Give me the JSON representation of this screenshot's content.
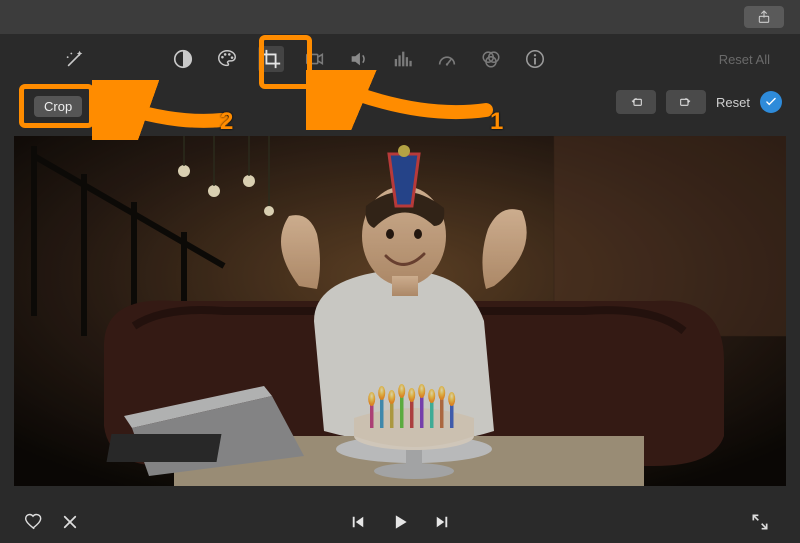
{
  "toolbar": {
    "share": "Share",
    "magic_wand": "Auto Enhance",
    "tools": [
      {
        "name": "color-balance",
        "label": "Color Balance"
      },
      {
        "name": "color-palette",
        "label": "Color Correction"
      },
      {
        "name": "crop",
        "label": "Crop"
      },
      {
        "name": "stabilize",
        "label": "Stabilization"
      },
      {
        "name": "volume",
        "label": "Volume"
      },
      {
        "name": "equalizer",
        "label": "Noise Reduction / EQ"
      },
      {
        "name": "speed",
        "label": "Speed"
      },
      {
        "name": "filters",
        "label": "Clip Filter"
      },
      {
        "name": "info",
        "label": "Info"
      }
    ],
    "reset_all": "Reset All"
  },
  "crop_mode": {
    "button_label": "Crop",
    "rotate_ccw": "Rotate CCW",
    "rotate_cw": "Rotate CW",
    "reset_label": "Reset",
    "apply": "Apply"
  },
  "annotations": {
    "step1": "1",
    "step2": "2"
  },
  "playback": {
    "favorite": "Favorite",
    "reject": "Reject",
    "prev": "Previous Frame",
    "play": "Play",
    "next": "Next Frame",
    "fullscreen": "Fullscreen"
  },
  "preview": {
    "description": "Man in white t-shirt blowing out birthday candles on a cake, wearing a party hat, seated on a leather couch indoors with a laptop nearby"
  }
}
